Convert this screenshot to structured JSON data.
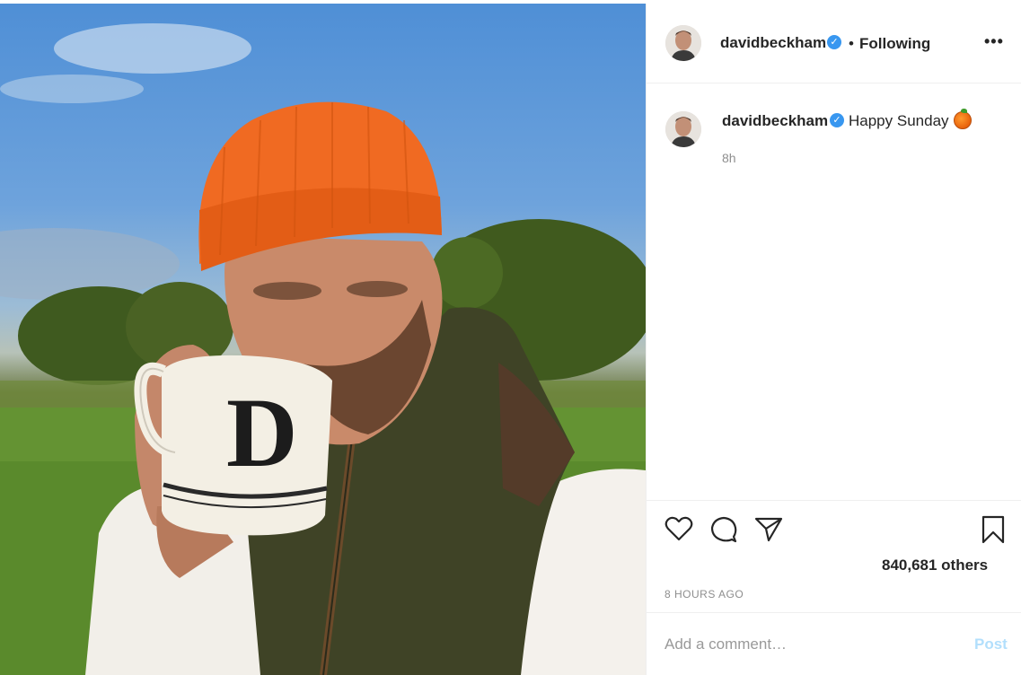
{
  "post": {
    "image_alt": "Photo of a man in an orange beanie drinking from a mug with the letter D",
    "mug_letter": "D"
  },
  "header": {
    "username": "davidbeckham",
    "verified_glyph": "✓",
    "separator": "•",
    "follow_state": "Following",
    "more_label": "•••"
  },
  "caption": {
    "username": "davidbeckham",
    "verified_glyph": "✓",
    "text": "Happy Sunday",
    "emoji": "orange-emoji",
    "time": "8h"
  },
  "actions": {
    "like_icon": "heart-icon",
    "comment_icon": "comment-icon",
    "share_icon": "share-icon",
    "save_icon": "bookmark-icon",
    "likes_text": "840,681 others",
    "time_ago": "8 HOURS AGO"
  },
  "comment": {
    "placeholder": "Add a comment…",
    "post_label": "Post"
  },
  "colors": {
    "verified": "#3897f0",
    "post_button": "#b2dffc",
    "beanie": "#f06a22"
  }
}
